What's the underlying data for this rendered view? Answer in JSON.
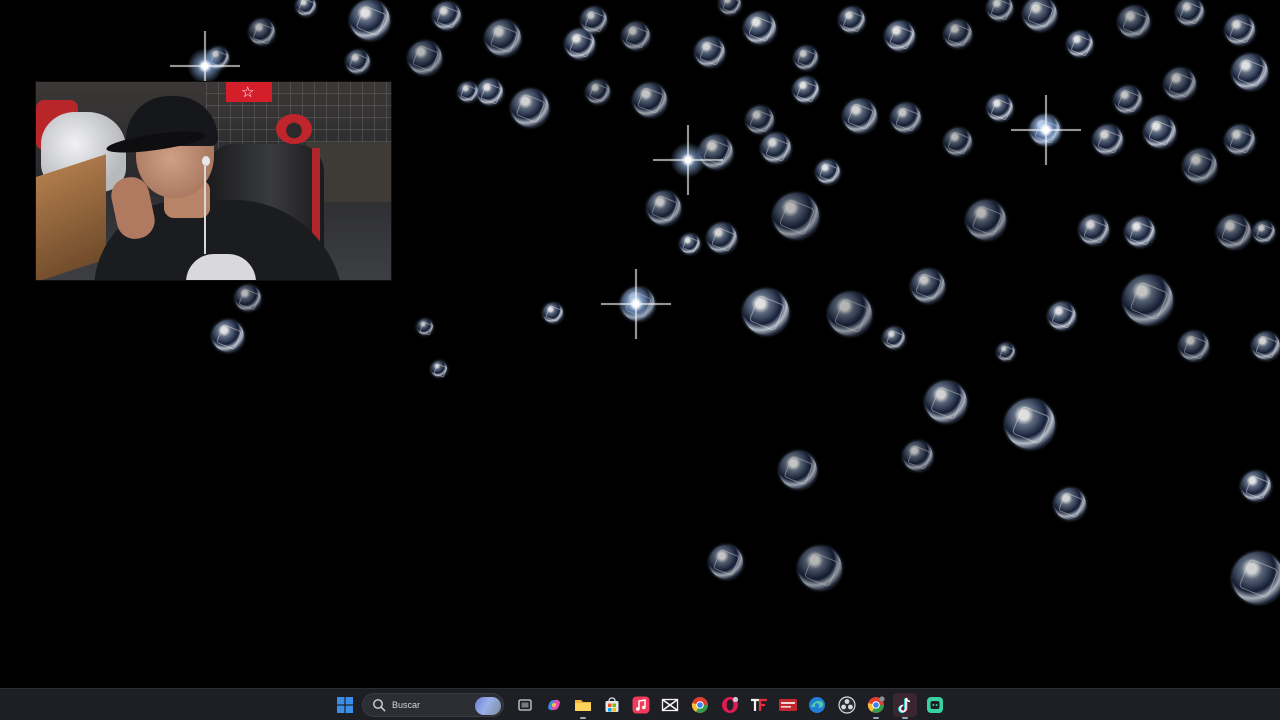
{
  "taskbar": {
    "search_placeholder": "Buscar",
    "pinned_icons": [
      "windows-start-icon",
      "search-icon",
      "task-view-icon",
      "copilot-icon",
      "file-explorer-icon",
      "microsoft-store-icon",
      "apple-music-icon",
      "capcut-icon",
      "chrome-icon",
      "opera-gx-icon",
      "tf-app-icon",
      "red-box-app-icon",
      "edge-icon",
      "obs-studio-icon",
      "chrome-profile-icon",
      "tiktok-icon",
      "green-app-icon"
    ]
  },
  "desktop": {
    "wallpaper": "diamonds-on-black"
  },
  "webcam": {
    "subject": "streamer-in-cap-and-hoodie"
  },
  "colors": {
    "taskbar_bg": "#1e1f25",
    "wallpaper_bg": "#000000",
    "windows_blue": "#3b8ee8",
    "tiktok_pink": "#e01a52"
  }
}
